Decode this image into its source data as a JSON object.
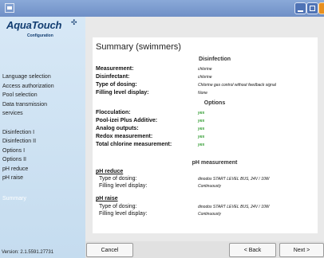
{
  "app": {
    "logo": "AquaTouch",
    "logo_subtitle": "Configuration"
  },
  "sidebar": {
    "items": [
      "Language selection",
      "Access authorization",
      "Pool selection",
      "Data transmission",
      "services",
      "Disinfection I",
      "Disinfection II",
      "Options I",
      "Options II",
      "pH reduce",
      "pH raise",
      "Summary"
    ],
    "active": "Summary",
    "version": "Version: 2.1.5591.27731"
  },
  "summary": {
    "title": "Summary (swimmers)",
    "disinfection": {
      "heading": "Disinfection",
      "rows": [
        {
          "label": "Measurement:",
          "value": "chlorine"
        },
        {
          "label": "Disinfectant:",
          "value": "chlorine"
        },
        {
          "label": "Type of dosing:",
          "value": "Chlorine gas control without feedback signal"
        },
        {
          "label": "Filling level display:",
          "value": "None"
        }
      ]
    },
    "options": {
      "heading": "Options",
      "rows": [
        {
          "label": "Flocculation:",
          "value": "yes"
        },
        {
          "label": "Pool-izei Plus Additive:",
          "value": "yes"
        },
        {
          "label": "Analog outputs:",
          "value": "yes"
        },
        {
          "label": "Redox measurement:",
          "value": "yes"
        },
        {
          "label": "Total chlorine measurement:",
          "value": "yes"
        }
      ]
    },
    "ph": {
      "heading": "pH measurement",
      "reduce": {
        "title": "pH reduce",
        "rows": [
          {
            "label": "Type of dosing:",
            "value": "dinodos START LEVEL BUS, 24V / 10W"
          },
          {
            "label": "Filling level display:",
            "value": "Continuously"
          }
        ]
      },
      "raise": {
        "title": "pH raise",
        "rows": [
          {
            "label": "Type of dosing:",
            "value": "dinodos START LEVEL BUS, 24V / 10W"
          },
          {
            "label": "Filling level display:",
            "value": "Continuously"
          }
        ]
      }
    }
  },
  "buttons": {
    "cancel": "Cancel",
    "back": "< Back",
    "next": "Next >"
  }
}
